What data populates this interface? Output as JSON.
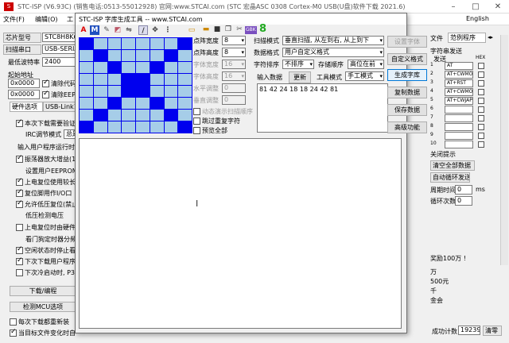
{
  "bg": {
    "title": "STC-ISP (V6.93C) (销售电话:0513-55012928) 官网:www.STCAI.com  (STC 宏晶ASC 0308 Cortex-M0 USB(U盘)软件下载 2021.6)",
    "menu": {
      "file": "文件(F)",
      "edit": "编辑(O)",
      "tools": "工",
      "language": "English"
    },
    "chip_label": "芯片型号",
    "chip_value": "STC8H8K64U",
    "scan_port": "扫描串口",
    "port_value": "USB-SERIAL",
    "min_baud_label": "最低波特率",
    "min_baud_value": "2400",
    "start_addr": "起始地址",
    "addr1": "0x0000",
    "addr2": "0x0000",
    "clear_code": "清除代码",
    "clear_eeprom": "清除EEPR",
    "hw_tab": "硬件选项",
    "hw_tab2": "USB-Link1",
    "opts": [
      "本次下载需要验证",
      "IRC调节模式",
      "输入用户程序运行时",
      "振荡器放大增益(1",
      "设置用户EEPROM大",
      "上电复位使用较长",
      "复位脚用作I/O口",
      "允许低压复位(禁止",
      "低压检测电压",
      "上电复位时由硬件",
      "看门狗定时器分频",
      "空闲状态时停止看",
      "下次下载用户程序",
      "下次冷启动时, P3."
    ],
    "irc_mode": "总是",
    "download": "下载/编程",
    "check_mcu": "检测MCU选项",
    "every_reload": "每次下载都重新装",
    "auto_reload": "当目标文件变化时自",
    "right_tabs": {
      "file": "文件",
      "examples": "范例程序"
    },
    "str_send": "字符串发送",
    "send_label": "发送",
    "hex_label": "HEX",
    "send_items": [
      "AT",
      "AT+CWMOD",
      "AT+RST",
      "AT+CWMOD",
      "AT+CWJAP",
      "",
      "",
      "",
      "",
      ""
    ],
    "close_tip": "关闭提示",
    "clear_all": "清空全部数据",
    "auto_loop": "自动循环发送",
    "period_label": "周期时间",
    "period_val": "0",
    "ms": "ms",
    "loop_label": "循环次数",
    "loop_val": "0",
    "ad1": "奖励100万 !",
    "ad2": "万",
    "ad3": "500元",
    "ad4": "千",
    "ad5": "金会",
    "success_label": "成功计数",
    "success_val": "19239",
    "clear": "清零"
  },
  "dlg": {
    "title": "STC-ISP 字库生成工具 -- www.STCAI.com",
    "width_label": "点阵宽度",
    "width_val": "8",
    "height_label": "点阵高度",
    "height_val": "8",
    "fw_label": "字体宽度",
    "fw_val": "16",
    "fh_label": "字体高度",
    "fh_val": "16",
    "hoff_label": "水平调整",
    "hoff_val": "0",
    "voff_label": "垂直调整",
    "voff_val": "0",
    "demo_scan": "动态演示扫描顺序",
    "skip_dup": "跳过重复字符",
    "preview_all": "预览全部",
    "scan_mode_label": "扫描模式",
    "scan_mode_val": "垂直扫描, 从左到右, 从上到下",
    "data_fmt_label": "数据格式",
    "data_fmt_val": "用户自定义格式",
    "char_sort_label": "字符排序",
    "char_sort_val": "不排序",
    "store_order_label": "存储顺序",
    "store_order_val": "高位在前",
    "input_label": "输入数据",
    "update": "更新",
    "tool_mode_label": "工具模式",
    "tool_mode_val": "手工模式",
    "hex_data": "81 42 24 18 18 24 42 81",
    "btn_font": "设置字体",
    "btn_custom": "自定义格式",
    "btn_gen": "生成字库",
    "btn_copy": "复制数据",
    "btn_save": "保存数据",
    "btn_adv": "高级功能",
    "gbk": "GBK",
    "eight": "8",
    "matrix": [
      [
        1,
        0,
        0,
        0,
        0,
        0,
        0,
        1
      ],
      [
        0,
        1,
        0,
        0,
        0,
        0,
        1,
        0
      ],
      [
        0,
        0,
        1,
        0,
        0,
        1,
        0,
        0
      ],
      [
        0,
        0,
        0,
        1,
        1,
        0,
        0,
        0
      ],
      [
        0,
        0,
        0,
        1,
        1,
        0,
        0,
        0
      ],
      [
        0,
        0,
        1,
        0,
        0,
        1,
        0,
        0
      ],
      [
        0,
        1,
        0,
        0,
        0,
        0,
        1,
        0
      ],
      [
        1,
        0,
        0,
        0,
        0,
        0,
        0,
        1
      ]
    ],
    "tb_icons": [
      "A",
      "M",
      "pen",
      "erase",
      "flip",
      "pencil",
      "move",
      "open",
      "save",
      "copy",
      "cut"
    ]
  },
  "colors": {
    "grid_on": "#0000ee",
    "grid_off": "#a6cde8"
  }
}
